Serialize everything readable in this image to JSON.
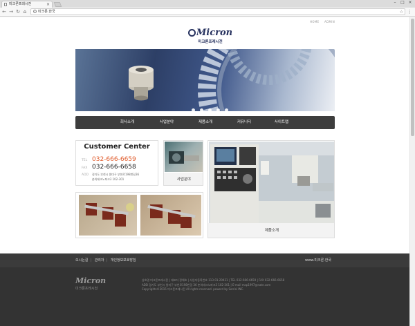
{
  "browser": {
    "tab_title": "미크론프레시전",
    "url": "미크론.한국"
  },
  "page": {
    "top_links": [
      "HOME",
      "ADMIN"
    ],
    "logo_text": "Micron",
    "logo_korean": "미크론프레시전",
    "nav": [
      "회사소개",
      "사업분야",
      "제품소개",
      "커뮤니티",
      "사이트맵"
    ],
    "customer_center": {
      "title": "Customer Center",
      "tel_label": "TEL",
      "tel": "032-666-6659",
      "fax_label": "FAX",
      "fax": "032-666-6658",
      "addr_label": "ADD",
      "addr_line1": "경기도 부천시 원미구 부천로198번길36",
      "addr_line2": "춘의테크노파크3 102-301"
    },
    "business_label": "사업분야",
    "products_label": "제품소개",
    "footer": {
      "links": [
        "오시는길",
        "관리자",
        "개인정보보호방침"
      ],
      "site": "www.미크론.한국",
      "logo_text": "Micron",
      "logo_korean": "미크론프레시전",
      "info_line1": "상호명 미크론프레시젼 | 대표자 정해호 | 사업자등록번호 113-01-29431 | TEL 032-666-6659 | FAX 032-666-6658",
      "info_line2": "ADD 경기도 부천시 원미구 부천로198번길 36 춘의테크노파크3 102-301 | E-mail msp1997@nate.com",
      "info_line3": "Copyrights©2015 미크론프레시전 All rights reserved. powerd by Sorrisi INC."
    }
  }
}
